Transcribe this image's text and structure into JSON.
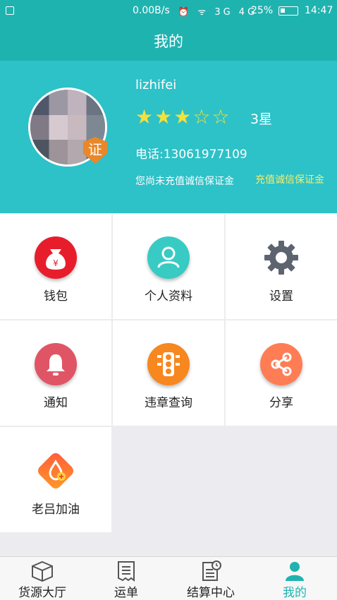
{
  "status_bar": {
    "speed": "0.00B/s",
    "indicators": "⏰ ᯤ 3G 4G",
    "battery": "25%",
    "time": "14:47"
  },
  "header": {
    "title": "我的"
  },
  "profile": {
    "username": "lizhifei",
    "rating_stars_filled": 3,
    "rating_stars_total": 5,
    "rating_text": "3星",
    "phone": "电话:13061977109",
    "deposit_note": "您尚未充值诚信保证金",
    "deposit_link": "充值诚信保证金",
    "badge": "证"
  },
  "grid": {
    "items": [
      {
        "label": "钱包",
        "icon": "wallet-icon"
      },
      {
        "label": "个人资料",
        "icon": "profile-icon"
      },
      {
        "label": "设置",
        "icon": "gear-icon"
      },
      {
        "label": "通知",
        "icon": "bell-icon"
      },
      {
        "label": "违章查询",
        "icon": "traffic-light-icon"
      },
      {
        "label": "分享",
        "icon": "share-icon"
      },
      {
        "label": "老吕加油",
        "icon": "fuel-drop-icon"
      }
    ]
  },
  "tabbar": {
    "tabs": [
      {
        "label": "货源大厅",
        "icon": "box-icon"
      },
      {
        "label": "运单",
        "icon": "waybill-icon"
      },
      {
        "label": "结算中心",
        "icon": "settlement-icon"
      },
      {
        "label": "我的",
        "icon": "person-icon",
        "active": true
      }
    ]
  },
  "colors": {
    "primary": "#1fb3b0",
    "header_bg": "#2dc1c8",
    "star": "#f4e13a",
    "link": "#f6ee6a"
  }
}
